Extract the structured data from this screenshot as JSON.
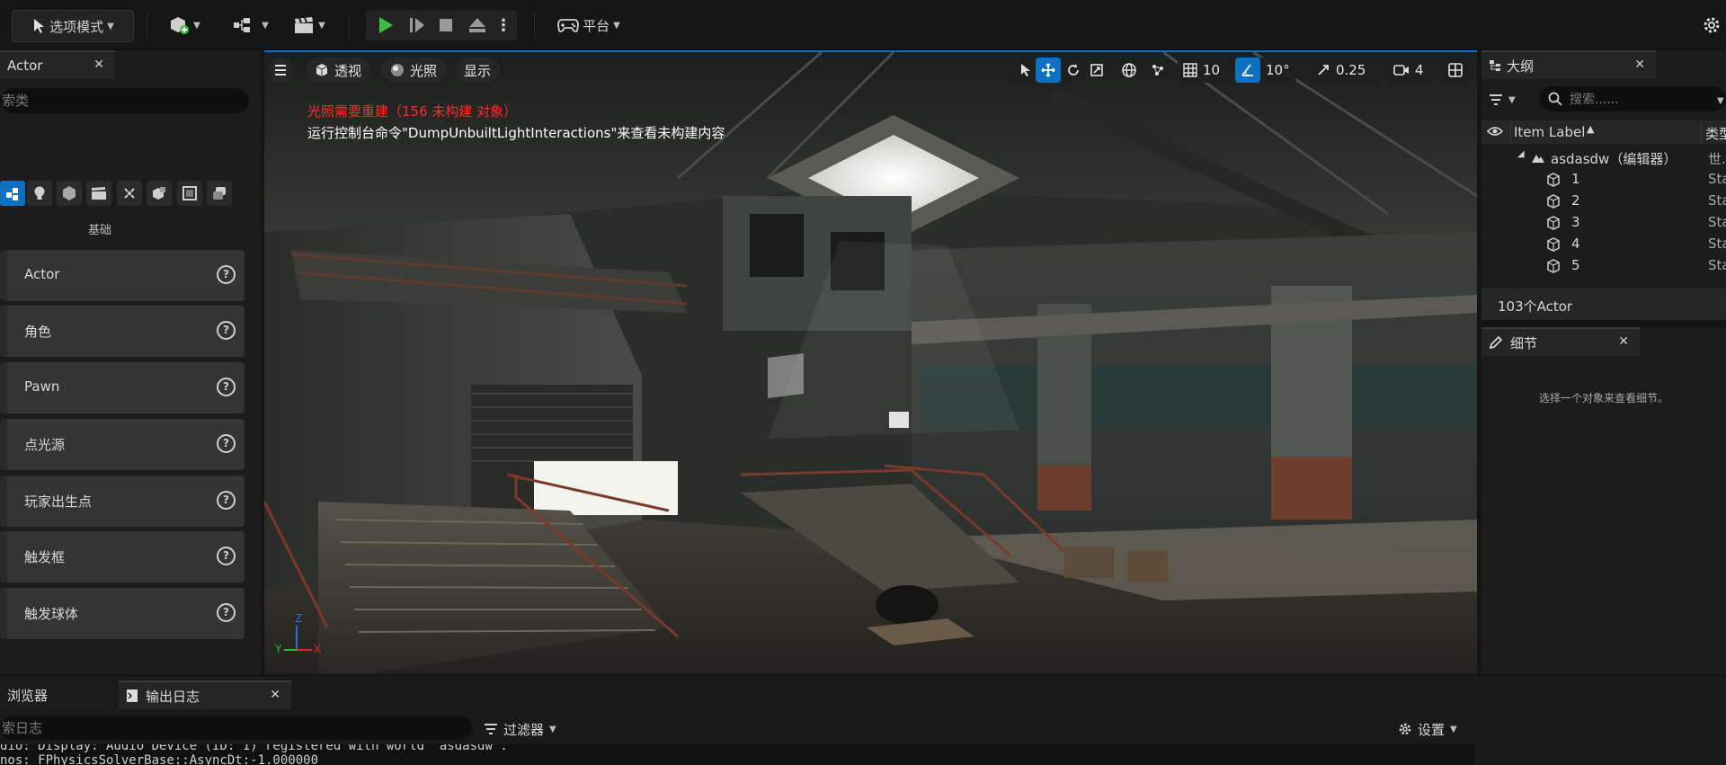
{
  "toolbar": {
    "mode_label": "选项模式",
    "platform_label": "平台"
  },
  "place_actors": {
    "tab_label": "Actor",
    "search_placeholder": "索类",
    "category_label": "基础",
    "items": [
      {
        "label": "Actor"
      },
      {
        "label": "角色"
      },
      {
        "label": "Pawn"
      },
      {
        "label": "点光源"
      },
      {
        "label": "玩家出生点"
      },
      {
        "label": "触发框"
      },
      {
        "label": "触发球体"
      }
    ]
  },
  "viewport": {
    "perspective_label": "透视",
    "lit_label": "光照",
    "show_label": "显示",
    "warning_line1": "光照需要重建（156 未构建 对象）",
    "warning_line2": "运行控制台命令\"DumpUnbuiltLightInteractions\"来查看未构建内容",
    "grid_snap_value": "10",
    "rotation_snap_value": "10°",
    "scale_snap_value": "0.25",
    "camera_speed_value": "4",
    "axis_x": "X",
    "axis_y": "Y",
    "axis_z": "Z"
  },
  "outliner": {
    "tab_label": "大纲",
    "search_placeholder": "搜索......",
    "col_item_label": "Item Label",
    "col_type": "类型",
    "world_name": "asdasdw（编辑器）",
    "world_type": "世...",
    "rows": [
      {
        "label": "1",
        "type": "Sta"
      },
      {
        "label": "2",
        "type": "Sta"
      },
      {
        "label": "3",
        "type": "Sta"
      },
      {
        "label": "4",
        "type": "Sta"
      },
      {
        "label": "5",
        "type": "Sta"
      }
    ],
    "actor_count": "103个Actor"
  },
  "details": {
    "tab_label": "细节",
    "empty_message": "选择一个对象来查看细节。"
  },
  "bottom": {
    "content_browser_tab": "浏览器",
    "output_log_tab": "输出日志",
    "search_placeholder": "索日志",
    "filter_label": "过滤器",
    "settings_label": "设置",
    "log_lines": [
      "dio: Display: Audio Device (ID: 1) registered with world 'asdasdw'.",
      "nos: FPhysicsSolverBase::AsyncDt:-1.000000"
    ]
  },
  "colors": {
    "play_green": "#3fbf3f",
    "accent_blue": "#0e70c0",
    "warning_red": "#ff2a2a"
  }
}
